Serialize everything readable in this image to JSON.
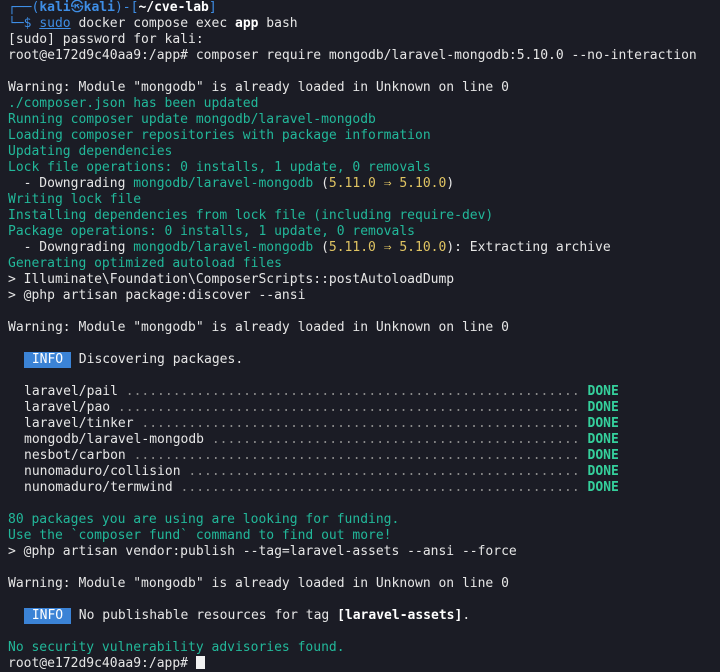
{
  "prompt": {
    "box_tl": "┌──(",
    "user": "kali",
    "skull": "㉿",
    "host": "kali",
    "mid": ")-[",
    "cwd": "~/cve-lab",
    "end": "]",
    "box_bl": "└─$ ",
    "cmd_sudo": "sudo",
    "cmd_rest1": " docker compose exec ",
    "cmd_app": "app",
    "cmd_rest2": " bash"
  },
  "lines": {
    "sudo_pw": "[sudo] password for kali:",
    "cmd1": "root@e172d9c40aa9:/app# composer require mongodb/laravel-mongodb:5.10.0 --no-interaction",
    "warn1": "Warning: Module \"mongodb\" is already loaded in Unknown on line 0",
    "json_updated": "./composer.json has been updated",
    "running_update": "Running composer update mongodb/laravel-mongodb",
    "loading_repos": "Loading composer repositories with package information",
    "updating_deps": "Updating dependencies",
    "lock_ops": "Lock file operations: 0 installs, 1 update, 0 removals",
    "downgrade1_prefix": "  - Downgrading ",
    "downgrade1_pkg": "mongodb/laravel-mongodb",
    "downgrade1_open": " (",
    "downgrade1_ver": "5.11.0 ⇒ 5.10.0",
    "downgrade1_close": ")",
    "writing_lock": "Writing lock file",
    "installing_deps": "Installing dependencies from lock file (including require-dev)",
    "package_ops": "Package operations: 0 installs, 1 update, 0 removals",
    "downgrade2_prefix": "  - Downgrading ",
    "downgrade2_pkg": "mongodb/laravel-mongodb",
    "downgrade2_open": " (",
    "downgrade2_ver": "5.11.0 ⇒ 5.10.0",
    "downgrade2_close": "): Extracting archive",
    "gen_autoload": "Generating optimized autoload files",
    "post_autoload": "> Illuminate\\Foundation\\ComposerScripts::postAutoloadDump",
    "artisan_discover": "> @php artisan package:discover --ansi",
    "warn2": "Warning: Module \"mongodb\" is already loaded in Unknown on line 0",
    "info1_badge": " INFO ",
    "info1_text": " Discovering packages.",
    "funding1": "80 packages you are using are looking for funding.",
    "funding2": "Use the `composer fund` command to find out more!",
    "vendor_publish": "> @php artisan vendor:publish --tag=laravel-assets --ansi --force",
    "warn3": "Warning: Module \"mongodb\" is already loaded in Unknown on line 0",
    "info2_badge": " INFO ",
    "info2_text_a": " No publishable resources for tag ",
    "info2_tag": "[laravel-assets]",
    "info2_text_b": ".",
    "no_vuln": "No security vulnerability advisories found.",
    "final_prompt": "root@e172d9c40aa9:/app# "
  },
  "packages": [
    {
      "name": "laravel/pail",
      "dots": " ..........................................................",
      "status": "DONE"
    },
    {
      "name": "laravel/pao",
      "dots": " ...........................................................",
      "status": "DONE"
    },
    {
      "name": "laravel/tinker",
      "dots": " ........................................................",
      "status": "DONE"
    },
    {
      "name": "mongodb/laravel-mongodb",
      "dots": " ...............................................",
      "status": "DONE"
    },
    {
      "name": "nesbot/carbon",
      "dots": " .........................................................",
      "status": "DONE"
    },
    {
      "name": "nunomaduro/collision",
      "dots": " ..................................................",
      "status": "DONE"
    },
    {
      "name": "nunomaduro/termwind",
      "dots": " ...................................................",
      "status": "DONE"
    }
  ]
}
